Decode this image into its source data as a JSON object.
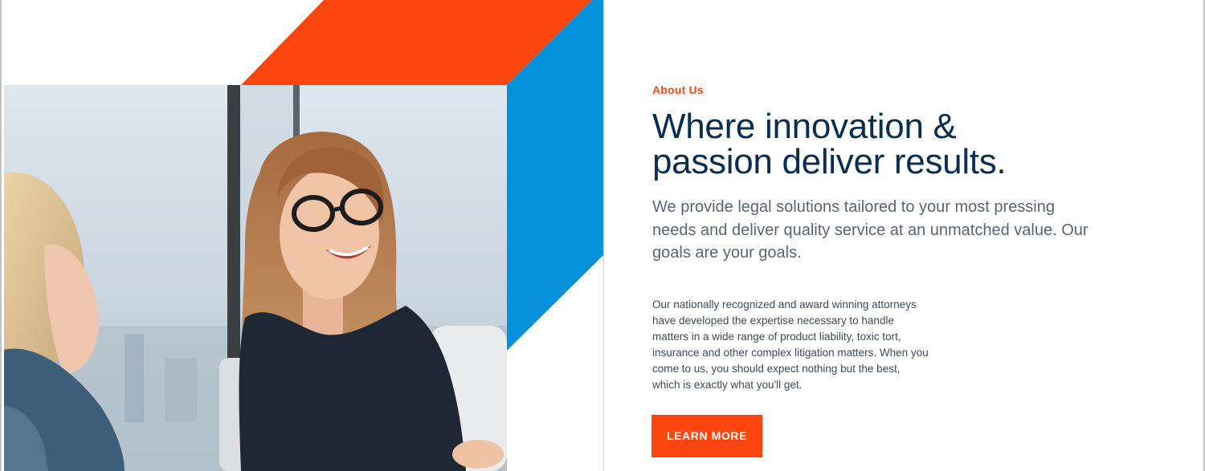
{
  "about": {
    "eyebrow": "About Us",
    "headline": "Where innovation & passion deliver results.",
    "lead": "We provide legal solutions tailored to your most pressing needs and deliver quality service at an unmatched value. Our goals are your goals.",
    "body": "Our nationally recognized and award winning attorneys have developed the expertise necessary to handle matters in a wide range of product liability, toxic tort, insurance and other complex litigation matters. When you come to us, you should expect nothing but the best, which is exactly what you'll get.",
    "cta_label": "LEARN MORE"
  },
  "colors": {
    "accent_orange": "#fd4510",
    "accent_blue": "#0590da",
    "heading_navy": "#0b2d4f"
  },
  "image": {
    "subject": "two-women-smiling-office-photo"
  }
}
